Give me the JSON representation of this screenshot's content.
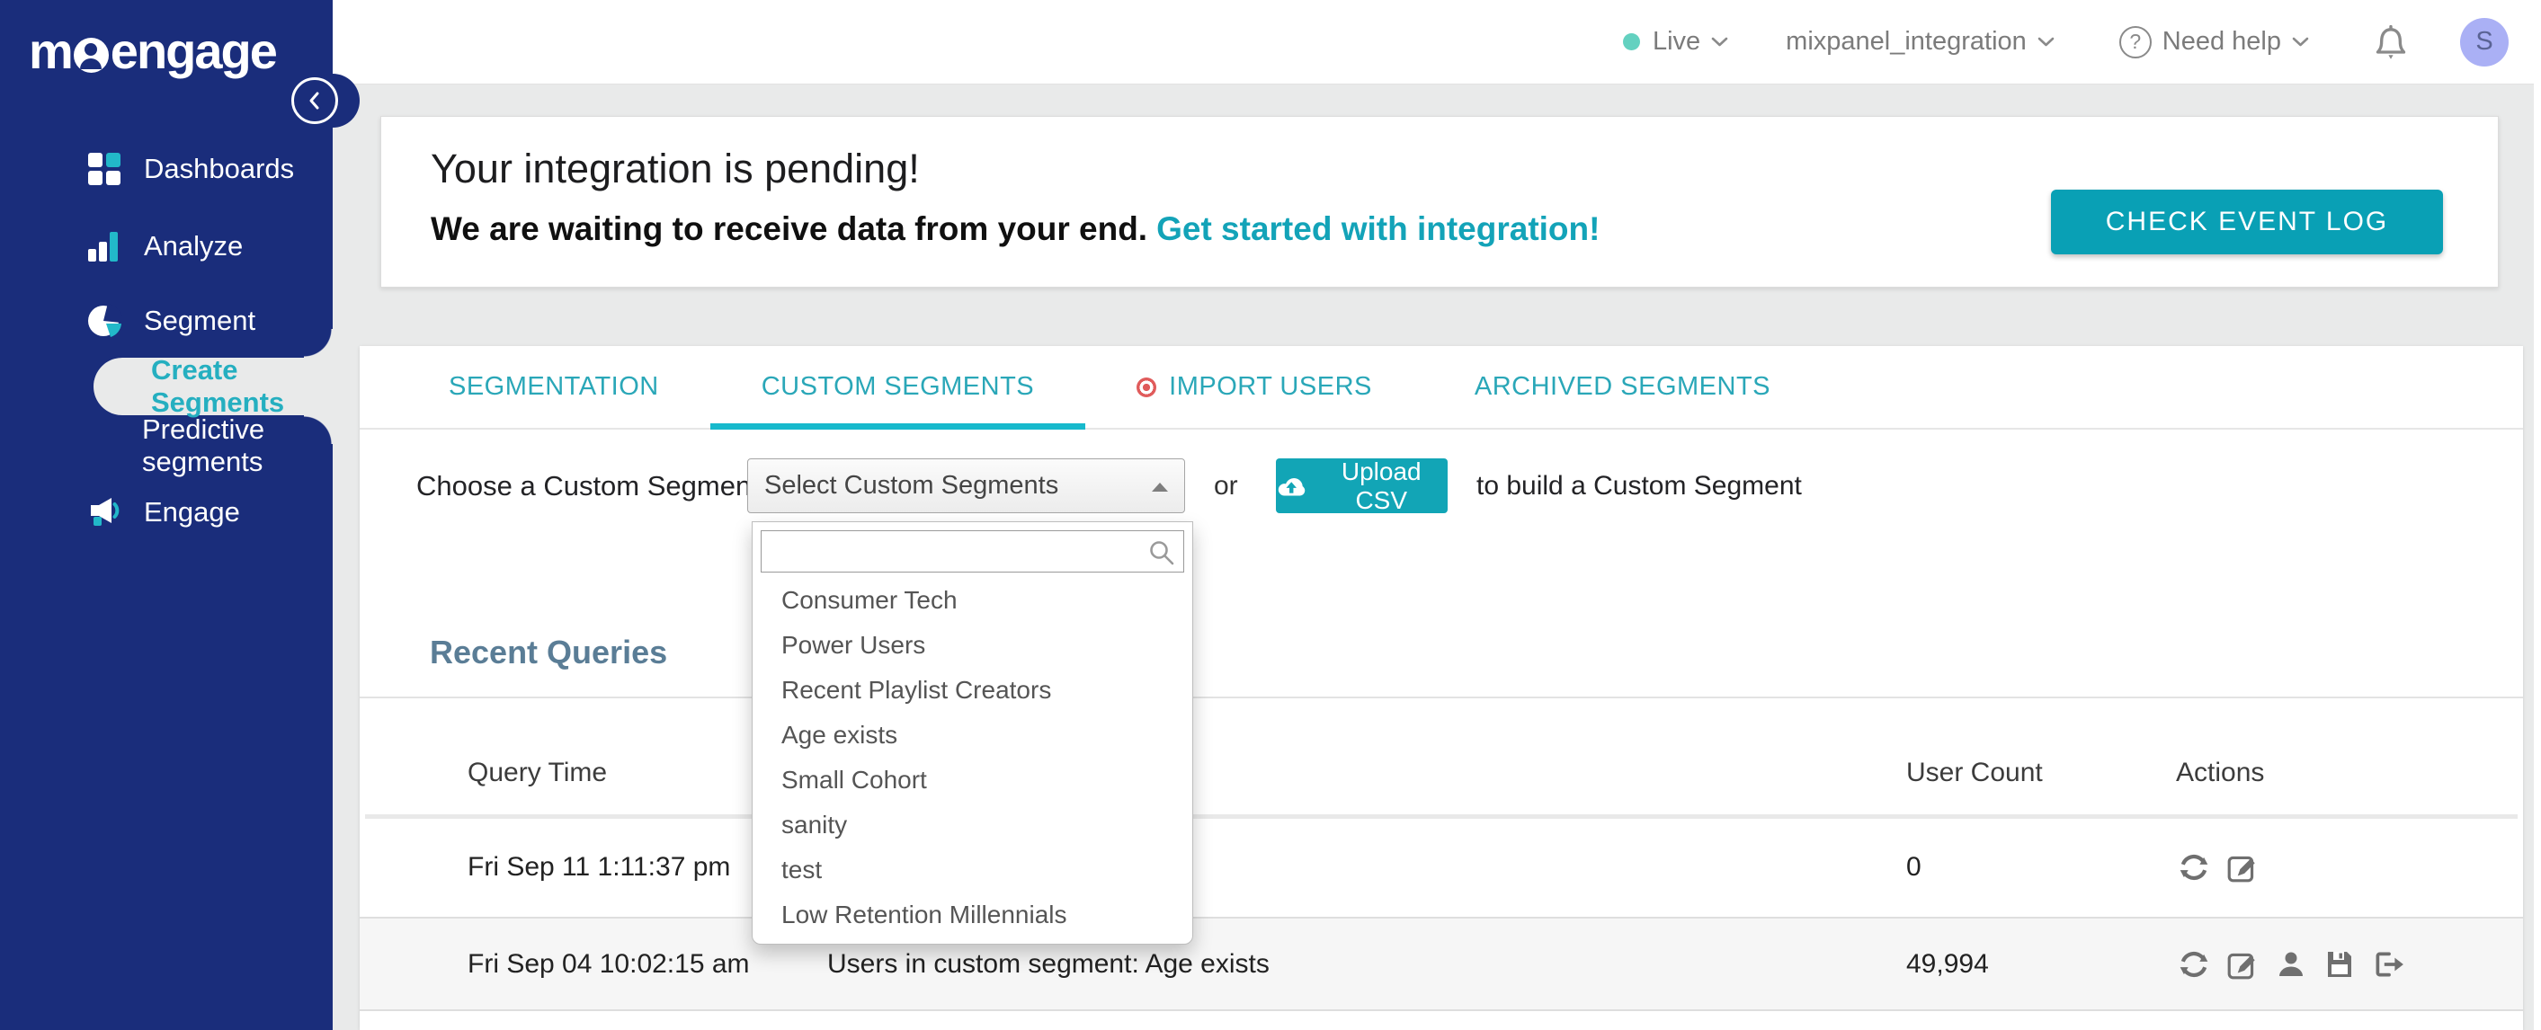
{
  "colors": {
    "sidebar_navy": "#1A2D7B",
    "accent_teal": "#12A5B6",
    "tab_teal": "#2AA7B8",
    "link_teal": "#13A3B8",
    "live_dot": "#63D1C0",
    "avatar_bg": "#AAB0F5",
    "import_badge_red": "#E05B5B",
    "section_title_slate": "#5A7D96"
  },
  "sidebar": {
    "logo": {
      "text": "moengage",
      "pre": "m",
      "post": "engage"
    },
    "items": [
      {
        "label": "Dashboards",
        "icon": "dashboards-icon"
      },
      {
        "label": "Analyze",
        "icon": "analyze-icon"
      },
      {
        "label": "Segment",
        "icon": "segment-icon"
      },
      {
        "label": "Create Segments",
        "active": true
      },
      {
        "label": "Predictive segments"
      },
      {
        "label": "Engage",
        "icon": "engage-icon"
      }
    ]
  },
  "header": {
    "env": "Live",
    "workspace": "mixpanel_integration",
    "help": "Need help",
    "help_icon": "question-icon",
    "bell_icon": "bell-icon",
    "avatar_initial": "S"
  },
  "banner": {
    "title": "Your integration is pending!",
    "subtitle": "We are waiting to receive data from your end.",
    "link": "Get started with integration!",
    "button": "CHECK EVENT LOG"
  },
  "tabs": [
    {
      "label": "SEGMENTATION",
      "active": false
    },
    {
      "label": "CUSTOM SEGMENTS",
      "active": true
    },
    {
      "label": "IMPORT USERS",
      "active": false,
      "badge_icon": "record-dot-icon"
    },
    {
      "label": "ARCHIVED SEGMENTS",
      "active": false
    }
  ],
  "chooser": {
    "label": "Choose a Custom Segment:",
    "select_value": "Select Custom Segments",
    "or": "or",
    "upload_button": "Upload CSV",
    "upload_icon": "cloud-upload-icon",
    "suffix": "to build a Custom Segment",
    "search_value": "",
    "search_icon": "search-icon",
    "options": [
      "Consumer Tech",
      "Power Users",
      "Recent Playlist Creators",
      "Age exists",
      "Small Cohort",
      "sanity",
      "test",
      "Low Retention Millennials"
    ]
  },
  "recent_queries": {
    "title": "Recent Queries",
    "columns": [
      "Query Time",
      "User Count",
      "Actions"
    ],
    "rows": [
      {
        "time": "Fri Sep 11 1:11:37 pm",
        "info": "",
        "count": "0",
        "actions": [
          "refresh-icon",
          "edit-icon"
        ]
      },
      {
        "time": "Fri Sep 04 10:02:15 am",
        "info": "Users in custom segment: Age exists",
        "count": "49,994",
        "actions": [
          "refresh-icon",
          "edit-icon",
          "user-icon",
          "save-icon",
          "export-icon"
        ]
      }
    ]
  }
}
